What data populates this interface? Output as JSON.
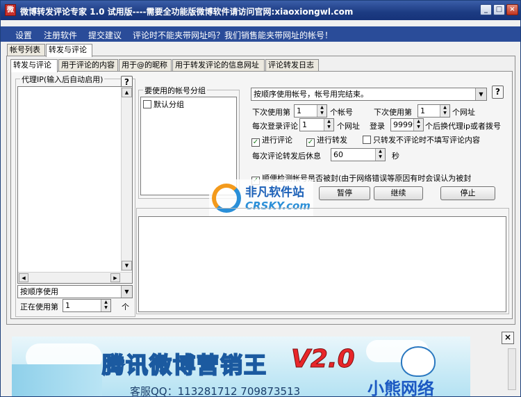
{
  "window": {
    "title": "微博转发评论专家  1.0  试用版----需要全功能版微博软件请访问官网:xiaoxiongwl.com",
    "app_icon": "微"
  },
  "menu": [
    "设置",
    "注册软件",
    "提交建议",
    "评论时不能夹带网址吗？我们销售能夹带网址的帐号！"
  ],
  "top_tabs": [
    "帐号列表",
    "转发与评论"
  ],
  "sub_tabs": [
    "转发与评论",
    "用于评论的内容",
    "用于@的昵称",
    "用于转发评论的信息网址",
    "评论转发日志"
  ],
  "proxy": {
    "title": "代理IP(输入后自动启用)",
    "order_select": "按顺序使用",
    "using_label": "正在使用第",
    "using_value": "1",
    "using_unit": "个"
  },
  "account_group": {
    "title": "要使用的帐号分组",
    "items": [
      {
        "label": "默认分组",
        "checked": false
      }
    ]
  },
  "settings": {
    "account_mode": "按顺序使用帐号，帐号用完结束。",
    "next_use_label": "下次使用第",
    "next_use_value": "1",
    "next_use_unit": "个帐号",
    "next_url_label": "下次使用第",
    "next_url_value": "1",
    "next_url_unit": "个网址",
    "per_login_label": "每次登录评论",
    "per_login_value": "1",
    "per_login_unit": "个网址",
    "login_label": "登录",
    "login_value": "999999",
    "login_unit": "个后换代理ip或者拨号",
    "chk_comment": "进行评论",
    "chk_repost": "进行转发",
    "chk_no_content": "只转发不评论时不填写评论内容",
    "rest_label": "每次评论转发后休息",
    "rest_value": "60",
    "rest_unit": "秒",
    "detect_label": "顺便检测帐号是否被封(由于网络错误等原因有时会误认为被封"
  },
  "buttons": {
    "pause": "暂停",
    "continue": "继续",
    "stop": "停止"
  },
  "watermark": {
    "cn": "非凡软件站",
    "en": "CRSKY.com"
  },
  "banner": {
    "headline": "腾讯微博营销王",
    "version": "V2.0",
    "qq": "客服QQ：113281712  709873513",
    "brand": "小熊网络"
  },
  "close_label": "×"
}
